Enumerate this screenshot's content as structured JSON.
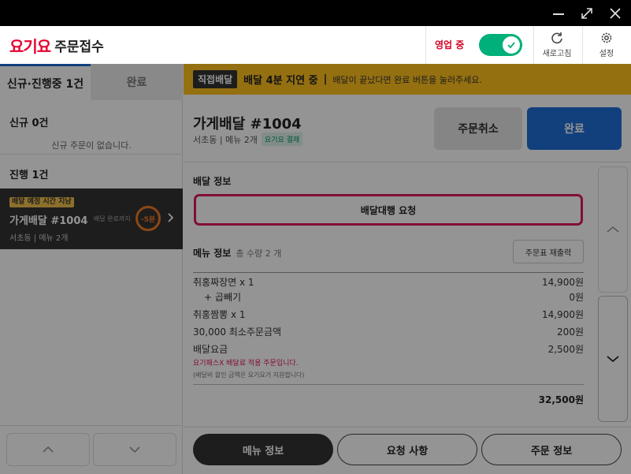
{
  "header": {
    "brand": "요기요",
    "sub": "주문접수",
    "open_label": "영업 중",
    "refresh_label": "새로고침",
    "settings_label": "설정"
  },
  "left": {
    "tabs": [
      {
        "label": "신규·진행중 1건"
      },
      {
        "label": "완료"
      }
    ],
    "new_title": "신규 0건",
    "new_empty": "신규 주문이 없습니다.",
    "progress_title": "진행 1건",
    "card": {
      "badge": "배달 예정 시간 지남",
      "title": "가게배달 #1004",
      "until": "배달 완료까지",
      "timer": "-5분",
      "sub": "서초동 | 메뉴 2개"
    }
  },
  "notice": {
    "tag": "직접배달",
    "title": "배달 4분 지연 중",
    "sep": "|",
    "message": "배달이 끝났다면 완료 버튼을 눌러주세요."
  },
  "order": {
    "title": "가게배달 #1004",
    "sub": "서초동 | 메뉴 2개",
    "pay_badge": "요기요 결제",
    "cancel_label": "주문취소",
    "done_label": "완료",
    "delivery_info_title": "배달 정보",
    "delivery_request_label": "배달대행 요청",
    "menu_info_title": "메뉴 정보",
    "menu_qty": "총 수량 2 개",
    "reprint_label": "주문표 재출력",
    "items": [
      {
        "name": "취홍짜장면  x 1",
        "price": "14,900원"
      },
      {
        "name": "+ 곱빼기",
        "price": "0원"
      },
      {
        "name": "취홍짬뽕  x 1",
        "price": "14,900원"
      },
      {
        "name": "30,000 최소주문금액",
        "price": "200원"
      },
      {
        "name": "배달요금",
        "price": "2,500원"
      }
    ],
    "pass_note": "요기패스X 배달료 적용 주문입니다.",
    "pass_sub": "(배달비 할인 금액은 요기요가 지원합니다)",
    "total": "32,500원"
  },
  "bottom_tabs": [
    {
      "label": "메뉴 정보"
    },
    {
      "label": "요청 사항"
    },
    {
      "label": "주문 정보"
    }
  ],
  "colors": {
    "brand_red": "#e6002d",
    "notice_yellow": "#ffc21e",
    "done_blue": "#1f6ed6",
    "toggle_green": "#00b07a",
    "highlight_pink": "#e0195f",
    "timer_orange": "#f07a24"
  }
}
